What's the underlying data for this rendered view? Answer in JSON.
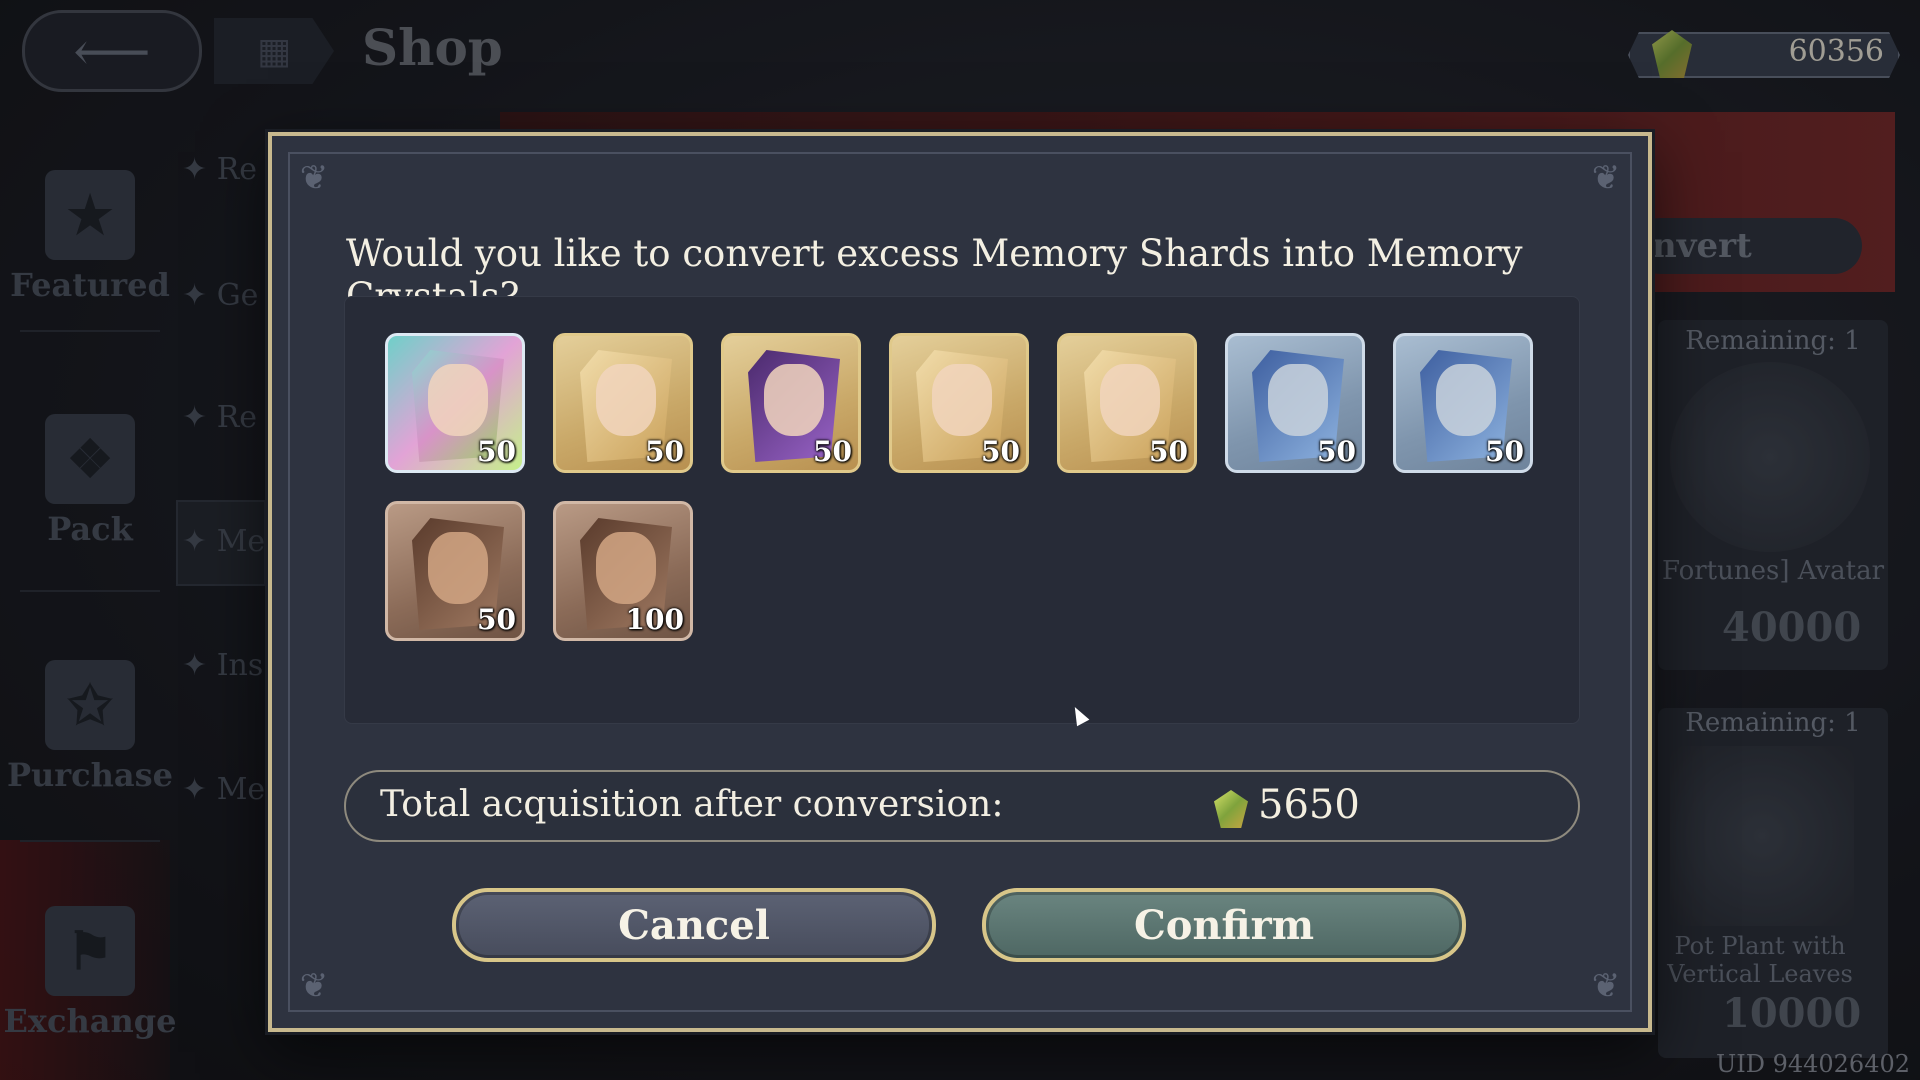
{
  "header": {
    "back_icon": "back-arrow-icon",
    "home_icon": "grid-icon",
    "title": "Shop"
  },
  "currency": {
    "icon": "memory-crystal-icon",
    "value": "60356"
  },
  "nav": {
    "items": [
      {
        "label": "Featured",
        "icon": "star-icon"
      },
      {
        "label": "Pack",
        "icon": "gift-icon"
      },
      {
        "label": "Purchase",
        "icon": "star-badge-icon"
      },
      {
        "label": "Exchange",
        "icon": "money-bag-icon"
      }
    ]
  },
  "submenu": {
    "items": [
      "Re",
      "Ge",
      "Re",
      "Me",
      "Ins",
      "Me"
    ]
  },
  "background_shop": {
    "convert_tab": "nvert",
    "card1": {
      "remaining": "Remaining:  1",
      "name": "Fortunes] Avatar",
      "price": "40000"
    },
    "card2": {
      "remaining": "Remaining:  1",
      "name": "Pot Plant with Vertical Leaves",
      "price": "10000"
    }
  },
  "uid": "UID 944026402",
  "dialog": {
    "question": "Would you like to convert excess Memory Shards into Memory Crystals?",
    "items": [
      {
        "rarity": "rainbow",
        "count": "50"
      },
      {
        "rarity": "gold",
        "count": "50"
      },
      {
        "rarity": "gold",
        "count": "50"
      },
      {
        "rarity": "gold",
        "count": "50"
      },
      {
        "rarity": "gold",
        "count": "50"
      },
      {
        "rarity": "silver",
        "count": "50"
      },
      {
        "rarity": "silver",
        "count": "50"
      },
      {
        "rarity": "bronze",
        "count": "50"
      },
      {
        "rarity": "bronze",
        "count": "100"
      }
    ],
    "total_label": "Total acquisition after conversion:",
    "total_icon": "memory-crystal-icon",
    "total_value": "5650",
    "cancel_label": "Cancel",
    "confirm_label": "Confirm"
  }
}
